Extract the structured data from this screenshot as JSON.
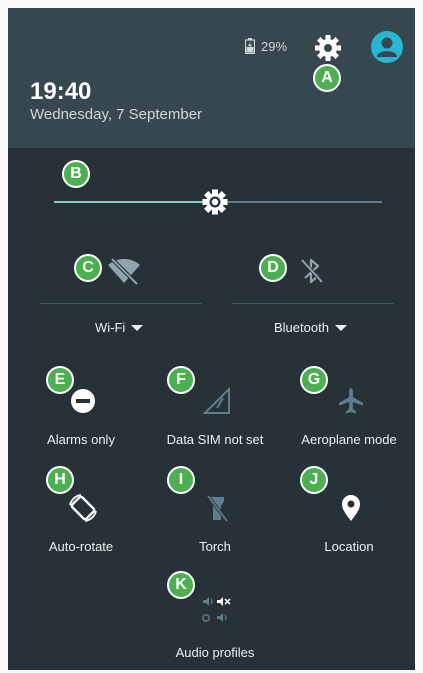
{
  "status": {
    "battery": "29%",
    "time": "19:40",
    "date": "Wednesday, 7 September"
  },
  "colors": {
    "panel": "#263238",
    "header": "#37474f",
    "accent": "#80cbc4",
    "badge": "#4caf50",
    "account": "#29b6d1"
  },
  "brightness": {
    "level": 0.49
  },
  "big_tiles": [
    {
      "label": "Wi-Fi",
      "icon": "wifi-off-icon"
    },
    {
      "label": "Bluetooth",
      "icon": "bluetooth-off-icon"
    }
  ],
  "tiles": [
    {
      "label": "Alarms only",
      "icon": "do-not-disturb-icon"
    },
    {
      "label": "Data SIM not set",
      "icon": "signal-none-icon"
    },
    {
      "label": "Aeroplane mode",
      "icon": "airplane-icon"
    },
    {
      "label": "Auto-rotate",
      "icon": "screen-rotation-icon"
    },
    {
      "label": "Torch",
      "icon": "flashlight-off-icon"
    },
    {
      "label": "Location",
      "icon": "location-pin-icon"
    },
    {
      "label": "Audio profiles",
      "icon": "audio-profiles-icon"
    }
  ],
  "callouts": [
    "A",
    "B",
    "C",
    "D",
    "E",
    "F",
    "G",
    "H",
    "I",
    "J",
    "K"
  ]
}
